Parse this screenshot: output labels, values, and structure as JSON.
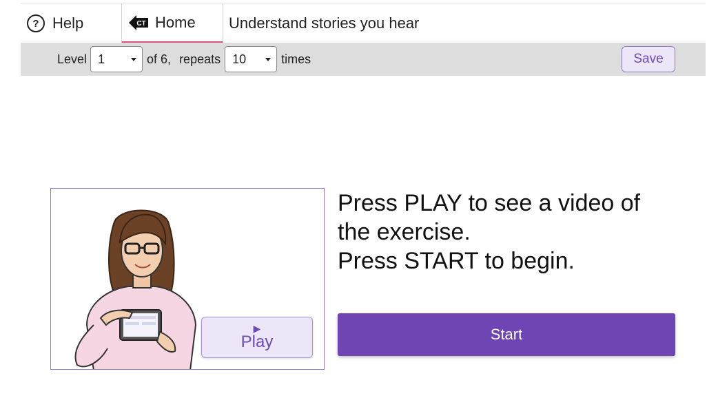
{
  "header": {
    "help_label": "Help",
    "home_label": "Home",
    "home_logo_text": "CT",
    "title": "Understand stories you hear"
  },
  "settings": {
    "level_label": "Level",
    "level_value": "1",
    "of_text": "of 6,",
    "repeats_label": "repeats",
    "repeats_value": "10",
    "times_text": "times",
    "save_label": "Save"
  },
  "preview": {
    "play_label": "Play"
  },
  "instructions": {
    "line1": "Press PLAY to see a video of",
    "line2": "the exercise.",
    "line3": "Press START to begin."
  },
  "start_label": "Start",
  "colors": {
    "accent": "#6f45b4",
    "home_underline": "#e3517a",
    "toolbar_bg": "#dddddd"
  }
}
